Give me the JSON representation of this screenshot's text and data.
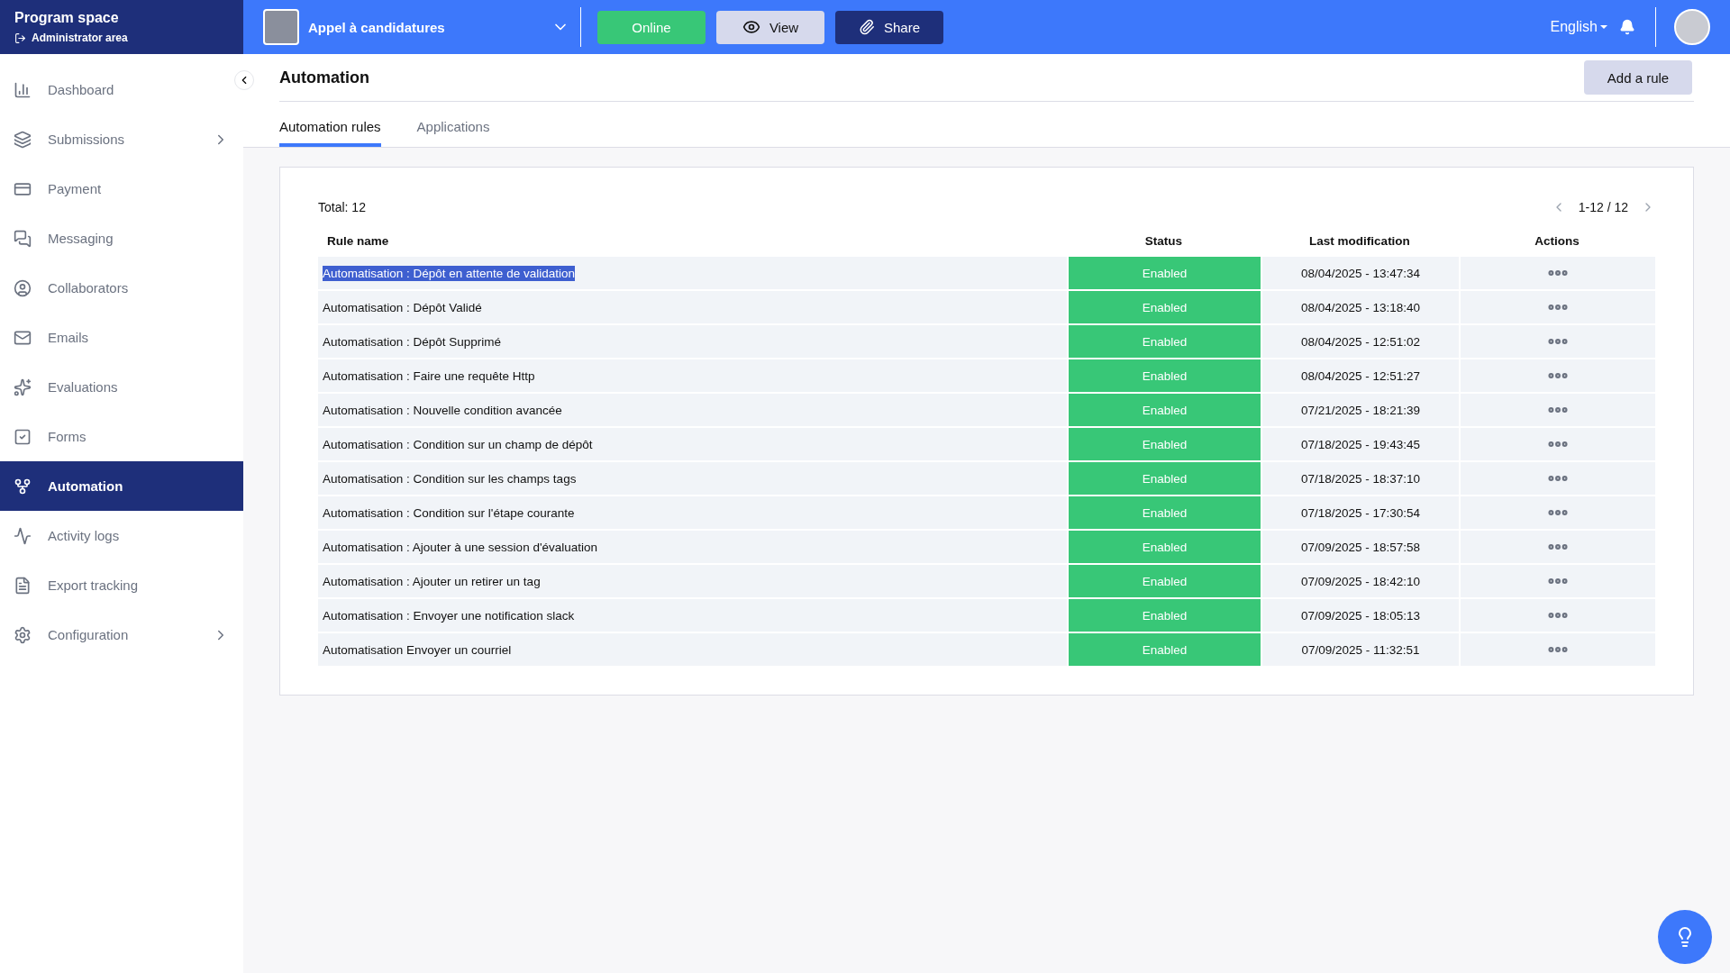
{
  "brand": {
    "title": "Program space",
    "subtitle": "Administrator area"
  },
  "topbar": {
    "program": "Appel à candidatures",
    "online": "Online",
    "view": "View",
    "share": "Share",
    "language": "English"
  },
  "sidebar": {
    "items": [
      {
        "label": "Dashboard",
        "selected": false,
        "expandable": false
      },
      {
        "label": "Submissions",
        "selected": false,
        "expandable": true
      },
      {
        "label": "Payment",
        "selected": false,
        "expandable": false
      },
      {
        "label": "Messaging",
        "selected": false,
        "expandable": false
      },
      {
        "label": "Collaborators",
        "selected": false,
        "expandable": false
      },
      {
        "label": "Emails",
        "selected": false,
        "expandable": false
      },
      {
        "label": "Evaluations",
        "selected": false,
        "expandable": false
      },
      {
        "label": "Forms",
        "selected": false,
        "expandable": false
      },
      {
        "label": "Automation",
        "selected": true,
        "expandable": false
      },
      {
        "label": "Activity logs",
        "selected": false,
        "expandable": false
      },
      {
        "label": "Export tracking",
        "selected": false,
        "expandable": false
      },
      {
        "label": "Configuration",
        "selected": false,
        "expandable": true
      }
    ]
  },
  "page": {
    "title": "Automation",
    "add_button": "Add a rule",
    "tabs": [
      {
        "label": "Automation rules",
        "selected": true
      },
      {
        "label": "Applications",
        "selected": false
      }
    ]
  },
  "table": {
    "total": "Total: 12",
    "pagination": "1-12 / 12",
    "columns": [
      "Rule name",
      "Status",
      "Last modification",
      "Actions"
    ],
    "rows": [
      {
        "name": "Automatisation : Dépôt en attente de validation",
        "status": "Enabled",
        "enabled": true,
        "modified": "08/04/2025 - 13:47:34",
        "selected": true
      },
      {
        "name": "Automatisation : Dépôt Validé",
        "status": "Enabled",
        "enabled": true,
        "modified": "08/04/2025 - 13:18:40",
        "selected": false
      },
      {
        "name": "Automatisation : Dépôt Supprimé",
        "status": "Enabled",
        "enabled": true,
        "modified": "08/04/2025 - 12:51:02",
        "selected": false
      },
      {
        "name": "Automatisation : Faire une requête Http",
        "status": "Enabled",
        "enabled": true,
        "modified": "08/04/2025 - 12:51:27",
        "selected": false
      },
      {
        "name": "Automatisation : Nouvelle condition avancée",
        "status": "Enabled",
        "enabled": true,
        "modified": "07/21/2025 - 18:21:39",
        "selected": false
      },
      {
        "name": "Automatisation : Condition sur un champ de dépôt",
        "status": "Enabled",
        "enabled": true,
        "modified": "07/18/2025 - 19:43:45",
        "selected": false
      },
      {
        "name": "Automatisation : Condition sur les champs tags",
        "status": "Enabled",
        "enabled": true,
        "modified": "07/18/2025 - 18:37:10",
        "selected": false
      },
      {
        "name": "Automatisation : Condition sur l'étape courante",
        "status": "Enabled",
        "enabled": true,
        "modified": "07/18/2025 - 17:30:54",
        "selected": false
      },
      {
        "name": "Automatisation : Ajouter à une session d'évaluation",
        "status": "Enabled",
        "enabled": true,
        "modified": "07/09/2025 - 18:57:58",
        "selected": false
      },
      {
        "name": "Automatisation : Ajouter un retirer un tag",
        "status": "Enabled",
        "enabled": true,
        "modified": "07/09/2025 - 18:42:10",
        "selected": false
      },
      {
        "name": "Automatisation : Envoyer une notification slack",
        "status": "Enabled",
        "enabled": true,
        "modified": "07/09/2025 - 18:05:13",
        "selected": false
      },
      {
        "name": "Automatisation Envoyer un courriel",
        "status": "Enabled",
        "enabled": true,
        "modified": "07/09/2025 - 11:32:51",
        "selected": false
      }
    ]
  }
}
